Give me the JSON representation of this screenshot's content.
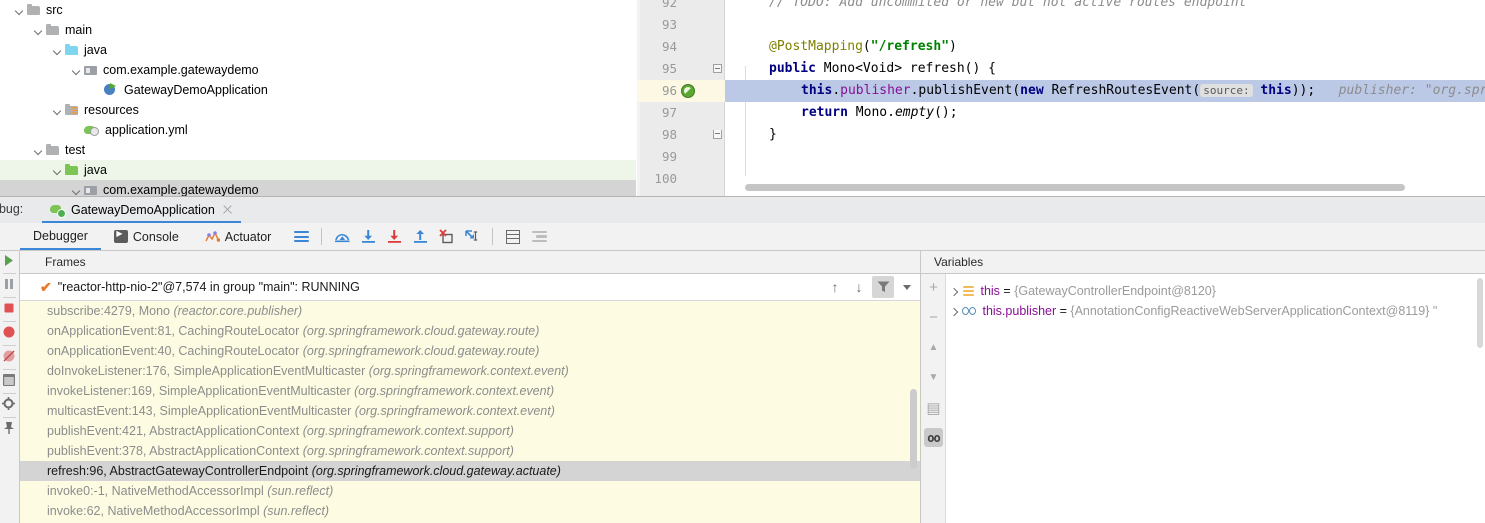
{
  "project_tree": {
    "items": [
      {
        "label": "src",
        "indent": 0,
        "icon": "folder-gray-icon",
        "chevron": true,
        "state": "normal"
      },
      {
        "label": "main",
        "indent": 1,
        "icon": "folder-gray-icon",
        "chevron": true,
        "state": "normal"
      },
      {
        "label": "java",
        "indent": 2,
        "icon": "folder-blue-source-icon",
        "chevron": true,
        "state": "normal"
      },
      {
        "label": "com.example.gatewaydemo",
        "indent": 3,
        "icon": "package-icon",
        "chevron": true,
        "state": "normal"
      },
      {
        "label": "GatewayDemoApplication",
        "indent": 4,
        "icon": "spring-boot-class-icon",
        "chevron": false,
        "state": "normal"
      },
      {
        "label": "resources",
        "indent": 2,
        "icon": "folder-resources-icon",
        "chevron": true,
        "state": "normal"
      },
      {
        "label": "application.yml",
        "indent": 3,
        "icon": "spring-yaml-icon",
        "chevron": false,
        "state": "normal"
      },
      {
        "label": "test",
        "indent": 1,
        "icon": "folder-gray-icon",
        "chevron": true,
        "state": "normal"
      },
      {
        "label": "java",
        "indent": 2,
        "icon": "folder-green-test-icon",
        "chevron": true,
        "state": "highlighted"
      },
      {
        "label": "com.example.gatewaydemo",
        "indent": 3,
        "icon": "package-icon",
        "chevron": true,
        "state": "selected"
      }
    ]
  },
  "editor": {
    "lines": [
      {
        "number": "92",
        "breakpoint": false,
        "fold": "",
        "current": false,
        "tokens": [
          {
            "t": "// TODO: Add uncommited or new but not active routes endpoint",
            "c": "cmt",
            "indent": 1
          }
        ]
      },
      {
        "number": "93",
        "breakpoint": false,
        "fold": "",
        "current": false,
        "tokens": []
      },
      {
        "number": "94",
        "breakpoint": false,
        "fold": "",
        "current": false,
        "tokens": [
          {
            "t": "@PostMapping",
            "c": "ann",
            "indent": 1
          },
          {
            "t": "(",
            "c": ""
          },
          {
            "t": "\"/refresh\"",
            "c": "str"
          },
          {
            "t": ")",
            "c": ""
          }
        ]
      },
      {
        "number": "95",
        "breakpoint": false,
        "fold": "open",
        "current": false,
        "tokens": [
          {
            "t": "public",
            "c": "kw",
            "indent": 1
          },
          {
            "t": " Mono<Void> refresh() {",
            "c": ""
          }
        ]
      },
      {
        "number": "96",
        "breakpoint": true,
        "fold": "",
        "current": true,
        "tokens": [
          {
            "t": "this",
            "c": "kw",
            "indent": 2
          },
          {
            "t": ".",
            "c": ""
          },
          {
            "t": "publisher",
            "c": "fld"
          },
          {
            "t": ".publishEvent(",
            "c": ""
          },
          {
            "t": "new",
            "c": "kw"
          },
          {
            "t": " RefreshRoutesEvent(",
            "c": ""
          },
          {
            "t": "source:",
            "c": "hintbox"
          },
          {
            "t": " ",
            "c": ""
          },
          {
            "t": "this",
            "c": "kw"
          },
          {
            "t": "));",
            "c": ""
          },
          {
            "t": "   publisher: \"org.sprin",
            "c": "hintgray"
          }
        ]
      },
      {
        "number": "97",
        "breakpoint": false,
        "fold": "",
        "current": false,
        "tokens": [
          {
            "t": "return",
            "c": "kw",
            "indent": 2
          },
          {
            "t": " Mono.",
            "c": ""
          },
          {
            "t": "empty",
            "c": "ital"
          },
          {
            "t": "();",
            "c": ""
          }
        ]
      },
      {
        "number": "98",
        "breakpoint": false,
        "fold": "close",
        "current": false,
        "tokens": [
          {
            "t": "}",
            "c": "",
            "indent": 1
          }
        ]
      },
      {
        "number": "99",
        "breakpoint": false,
        "fold": "",
        "current": false,
        "tokens": []
      },
      {
        "number": "100",
        "breakpoint": false,
        "fold": "",
        "current": false,
        "tokens": []
      }
    ]
  },
  "debug_window": {
    "debug_label": "ebug:",
    "run_tab": {
      "label": "GatewayDemoApplication",
      "close_label": "×"
    },
    "tabs": [
      {
        "label": "Debugger",
        "icon": "",
        "active": true
      },
      {
        "label": "Console",
        "icon": "console-icon",
        "active": false
      },
      {
        "label": "Actuator",
        "icon": "actuator-icon",
        "active": false
      }
    ],
    "toolbar_buttons": [
      {
        "name": "layout-settings-icon",
        "title": ""
      },
      {
        "name": "step-over-icon",
        "title": ""
      },
      {
        "name": "step-into-icon",
        "title": ""
      },
      {
        "name": "force-step-into-icon",
        "title": ""
      },
      {
        "name": "step-out-icon",
        "title": ""
      },
      {
        "name": "drop-frame-icon",
        "title": ""
      },
      {
        "name": "run-to-cursor-icon",
        "title": ""
      },
      {
        "name": "evaluate-expression-icon",
        "title": ""
      },
      {
        "name": "settings-lines-icon",
        "title": ""
      }
    ]
  },
  "frames_panel": {
    "header": "Frames",
    "thread": "\"reactor-http-nio-2\"@7,574 in group \"main\": RUNNING",
    "thread_tools": [
      {
        "name": "frame-up-icon"
      },
      {
        "name": "frame-down-icon"
      },
      {
        "name": "filter-funnel-icon"
      },
      {
        "name": "filter-dropdown-icon"
      }
    ],
    "frames": [
      {
        "method": "subscribe:4279, Mono ",
        "pkg": "(reactor.core.publisher)",
        "selected": false
      },
      {
        "method": "onApplicationEvent:81, CachingRouteLocator ",
        "pkg": "(org.springframework.cloud.gateway.route)",
        "selected": false
      },
      {
        "method": "onApplicationEvent:40, CachingRouteLocator ",
        "pkg": "(org.springframework.cloud.gateway.route)",
        "selected": false
      },
      {
        "method": "doInvokeListener:176, SimpleApplicationEventMulticaster ",
        "pkg": "(org.springframework.context.event)",
        "selected": false
      },
      {
        "method": "invokeListener:169, SimpleApplicationEventMulticaster ",
        "pkg": "(org.springframework.context.event)",
        "selected": false
      },
      {
        "method": "multicastEvent:143, SimpleApplicationEventMulticaster ",
        "pkg": "(org.springframework.context.event)",
        "selected": false
      },
      {
        "method": "publishEvent:421, AbstractApplicationContext ",
        "pkg": "(org.springframework.context.support)",
        "selected": false
      },
      {
        "method": "publishEvent:378, AbstractApplicationContext ",
        "pkg": "(org.springframework.context.support)",
        "selected": false
      },
      {
        "method": "refresh:96, AbstractGatewayControllerEndpoint ",
        "pkg": "(org.springframework.cloud.gateway.actuate)",
        "selected": true
      },
      {
        "method": "invoke0:-1, NativeMethodAccessorImpl ",
        "pkg": "(sun.reflect)",
        "selected": false
      },
      {
        "method": "invoke:62, NativeMethodAccessorImpl ",
        "pkg": "(sun.reflect)",
        "selected": false
      }
    ]
  },
  "variables_panel": {
    "header": "Variables",
    "side_buttons": [
      {
        "name": "add-watch-icon",
        "glyph": "+",
        "active": false
      },
      {
        "name": "remove-watch-icon",
        "glyph": "−",
        "active": false
      },
      {
        "name": "move-watch-up-icon",
        "glyph": "▲",
        "active": false
      },
      {
        "name": "move-watch-down-icon",
        "glyph": "▼",
        "active": false
      },
      {
        "name": "copy-value-icon",
        "glyph": "▤",
        "active": false
      },
      {
        "name": "inline-watches-icon",
        "glyph": "oo",
        "active": true
      }
    ],
    "rows": [
      {
        "icon": "field-icon",
        "name": "this",
        "eq": " = ",
        "value": "{GatewayControllerEndpoint@8120}"
      },
      {
        "icon": "glasses-watch-icon",
        "name": "this.publisher",
        "eq": " = ",
        "value": "{AnnotationConfigReactiveWebServerApplicationContext@8119} \""
      }
    ]
  },
  "colors": {
    "accent_blue": "#3b87d6",
    "frames_bg": "#fdfce3",
    "selection_gray": "#d4d4d4",
    "current_line": "#bcc9e6",
    "breakpoint_green": "#5aa832"
  }
}
